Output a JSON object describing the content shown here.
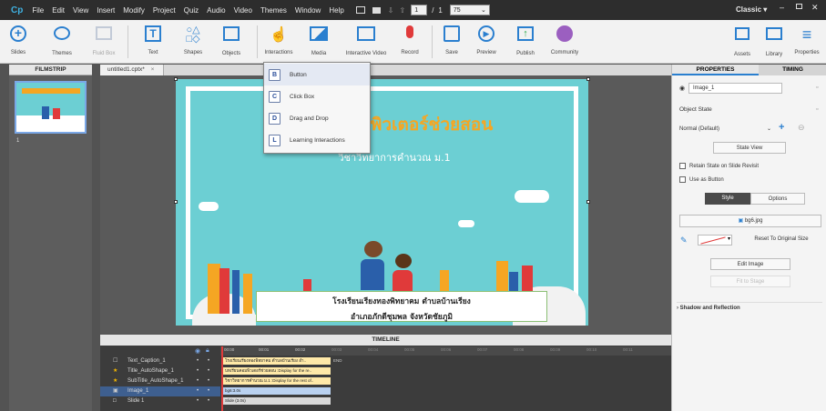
{
  "menubar": {
    "app_logo": "Cp",
    "items": [
      "File",
      "Edit",
      "View",
      "Insert",
      "Modify",
      "Project",
      "Quiz",
      "Audio",
      "Video",
      "Themes",
      "Window",
      "Help"
    ],
    "slide_current": "1",
    "slide_separator": "/",
    "slide_total": "1",
    "zoom": "75",
    "workspace": "Classic"
  },
  "toolbar": {
    "left": [
      "Slides",
      "Themes",
      "Fluid Box",
      "Text",
      "Shapes",
      "Objects",
      "Interactions",
      "Media",
      "Interactive Video",
      "Record",
      "Save",
      "Preview",
      "Publish",
      "Community"
    ],
    "right": [
      "Assets",
      "Library",
      "Properties"
    ]
  },
  "filmstrip": {
    "header": "FILMSTRIP",
    "thumb_number": "1"
  },
  "tab": {
    "label": "untitled1.cptx*",
    "close": "×"
  },
  "dropdown": {
    "items": [
      {
        "icon": "B",
        "label": "Button"
      },
      {
        "icon": "C",
        "label": "Click Box"
      },
      {
        "icon": "D",
        "label": "Drag and Drop"
      },
      {
        "icon": "L",
        "label": "Learning Interactions"
      }
    ]
  },
  "slide": {
    "title_line1": "บทเรียนคอมพิวเตอร์ช่วยสอน",
    "subtitle": "วิชาวิทยาการคำนวณ ม.1",
    "caption_line1": "โรงเรียนเรียงทองพิทยาคม ตำบลบ้านเรียง",
    "caption_line2": "อำเภอภักดีชุมพล จังหวัดชัยภูมิ"
  },
  "timeline": {
    "header": "TIMELINE",
    "rows": [
      {
        "name": "Text_Caption_1",
        "bar": "โรงเรียนเรียงทองพิทยาคม ตำบลบ้านเรียง อำ..",
        "selected": false
      },
      {
        "name": "Title_AutoShape_1",
        "bar": "บทเรียนคอมพิวเตอร์ช่วยสอน :Display for the re..",
        "selected": false
      },
      {
        "name": "SubTitle_AutoShape_1",
        "bar": "วิชาวิทยาการคำนวณ ม.1 :Display for the rest of..",
        "selected": false
      },
      {
        "name": "Image_1",
        "bar": "bg6:3.0s",
        "selected": true
      },
      {
        "name": "Slide 1",
        "bar": "Slide (3.0s)",
        "selected": false
      }
    ],
    "end_label": "END",
    "ticks": [
      "00:00",
      "00:01",
      "00:02",
      "00:03",
      "00:04",
      "00:05",
      "00:06",
      "00:07",
      "00:08",
      "00:09",
      "00:10",
      "00:11"
    ]
  },
  "properties": {
    "tab_properties": "PROPERTIES",
    "tab_timing": "TIMING",
    "object_name": "Image_1",
    "object_state_label": "Object State",
    "state_value": "Normal (Default)",
    "state_view": "State View",
    "retain_state": "Retain State on Slide Revisit",
    "use_as_button": "Use as Button",
    "style_tab": "Style",
    "options_tab": "Options",
    "image_file": "bg6.jpg",
    "reset_size": "Reset To Original Size",
    "edit_image": "Edit Image",
    "fit_to_stage": "Fit to Stage",
    "shadow_reflection": "Shadow and Reflection"
  },
  "colors": {
    "menubar_bg": "#2d2d2d",
    "slide_bg": "#6ccfd3",
    "title_orange": "#f5a623",
    "accent_blue": "#2a7fcf"
  }
}
